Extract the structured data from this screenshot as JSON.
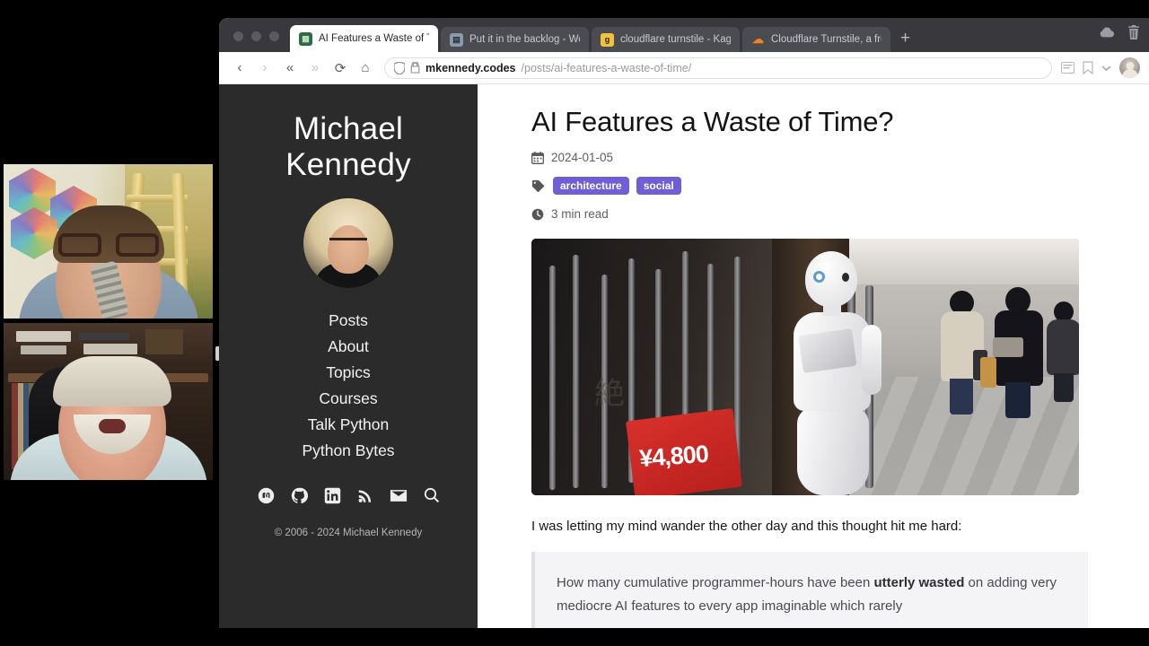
{
  "browser": {
    "tabs": [
      {
        "label": "AI Features a Waste of Tim",
        "favicon": "mkennedy-favicon",
        "active": true
      },
      {
        "label": "Put it in the backlog - Wor",
        "favicon": "worklog-favicon",
        "active": false
      },
      {
        "label": "cloudflare turnstile - Kagi",
        "favicon": "kagi-favicon",
        "active": false
      },
      {
        "label": "Cloudflare Turnstile, a fre",
        "favicon": "cloudflare-favicon",
        "active": false
      }
    ],
    "new_tab_label": "+",
    "url": {
      "domain": "mkennedy.codes",
      "path": "/posts/ai-features-a-waste-of-time/"
    },
    "toolbar_icons": {
      "back": "back-icon",
      "forward": "forward-icon",
      "rewind": "rewind-icon",
      "fast_forward": "fast-forward-icon",
      "reload": "reload-icon",
      "home": "home-icon",
      "shield": "shield-icon",
      "lock": "lock-icon",
      "reader": "reader-icon",
      "bookmark": "bookmark-icon",
      "chevron": "chevron-down-icon",
      "profile": "profile-avatar"
    },
    "window_icons": {
      "cloud": "cloud-icon",
      "trash": "trash-icon"
    }
  },
  "site": {
    "name_line1": "Michael",
    "name_line2": "Kennedy",
    "avatar": "site-avatar",
    "nav": [
      {
        "label": "Posts"
      },
      {
        "label": "About"
      },
      {
        "label": "Topics"
      },
      {
        "label": "Courses"
      },
      {
        "label": "Talk Python"
      },
      {
        "label": "Python Bytes"
      }
    ],
    "socials": [
      {
        "name": "mastodon-icon"
      },
      {
        "name": "github-icon"
      },
      {
        "name": "linkedin-icon"
      },
      {
        "name": "rss-icon"
      },
      {
        "name": "email-icon"
      },
      {
        "name": "search-icon"
      }
    ],
    "copyright": "© 2006 - 2024 Michael Kennedy"
  },
  "post": {
    "title": "AI Features a Waste of Time?",
    "date": "2024-01-05",
    "tags": [
      "architecture",
      "social"
    ],
    "read_time": "3 min read",
    "hero_alt": "Pepper robot standing in a Japanese shopping arcade next to a red 4,800 yen price sign",
    "hero_price_sign": "¥4,800",
    "hero_kanji": "絶",
    "paragraph": "I was letting my mind wander the other day and this thought hit me hard:",
    "quote_part1": "How many cumulative programmer-hours have been ",
    "quote_emphasis": "utterly wasted",
    "quote_part2": " on adding very mediocre AI features to every app imaginable which rarely"
  },
  "webcams": [
    {
      "name": "webcam-top",
      "description": "Man with dark-rimmed glasses in a room with hexagon wall art and a wooden ladder"
    },
    {
      "name": "webcam-bottom",
      "description": "Older man with white hair and moustache seated in an office chair in front of a bookshelf"
    }
  ],
  "colors": {
    "tag_purple": "#6f5fd6",
    "sidebar_bg": "#2b2b2b",
    "tabstrip_bg": "#38383d",
    "page_bg": "#ffffff"
  }
}
